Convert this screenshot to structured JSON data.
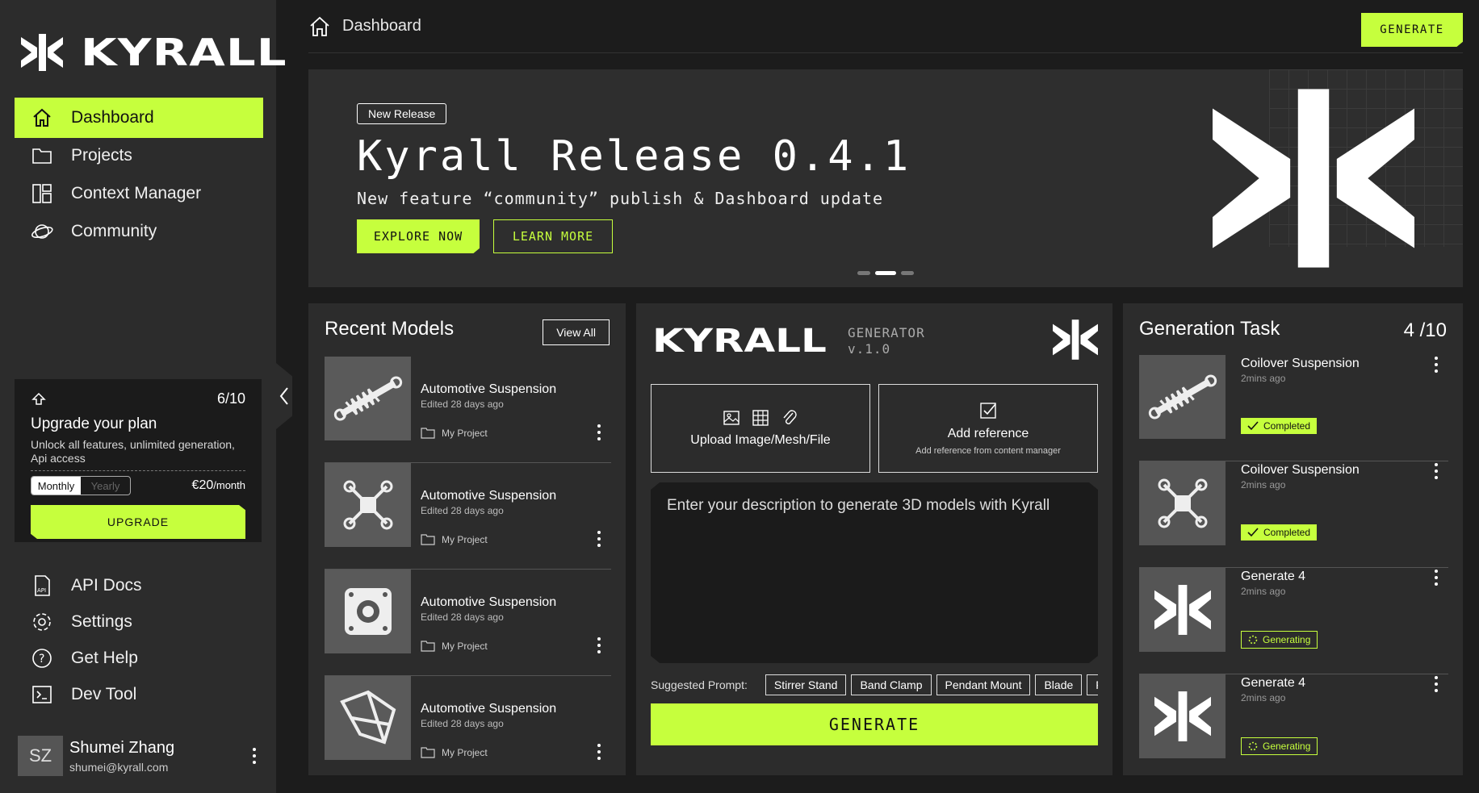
{
  "brand": "KYRALL",
  "sidebar": {
    "nav": [
      "Dashboard",
      "Projects",
      "Context Manager",
      "Community"
    ],
    "bottom_nav": [
      "API Docs",
      "Settings",
      "Get Help",
      "Dev Tool"
    ],
    "upgrade": {
      "count": "6/10",
      "title": "Upgrade your plan",
      "desc": "Unlock all features, unlimited  generation, Api access",
      "monthly": "Monthly",
      "yearly": "Yearly",
      "price": "€20",
      "per": "/month",
      "button": "UPGRADE"
    },
    "user": {
      "initials": "SZ",
      "name": "Shumei Zhang",
      "email": "shumei@kyrall.com"
    }
  },
  "header": {
    "breadcrumb": "Dashboard",
    "generate": "GENERATE"
  },
  "banner": {
    "badge": "New Release",
    "title": "Kyrall Release 0.4.1",
    "subtitle": "New feature “community” publish & Dashboard update",
    "explore": "EXPLORE NOW",
    "learn": "LEARN MORE"
  },
  "recent": {
    "title": "Recent Models",
    "view_all": "View All",
    "items": [
      {
        "name": "Automotive Suspension",
        "edited": "Edited 28 days ago",
        "project": "My Project"
      },
      {
        "name": "Automotive Suspension",
        "edited": "Edited 28 days ago",
        "project": "My Project"
      },
      {
        "name": "Automotive Suspension",
        "edited": "Edited 28 days ago",
        "project": "My Project"
      },
      {
        "name": "Automotive Suspension",
        "edited": "Edited 28 days ago",
        "project": "My Project"
      }
    ]
  },
  "generator": {
    "logo": "KYRALL",
    "label": "GENERATOR",
    "version": "v.1.0",
    "upload": "Upload Image/Mesh/File",
    "ref_title": "Add reference",
    "ref_sub": "Add reference from content manager",
    "placeholder": "Enter your description to generate 3D models with Kyrall",
    "suggest_label": "Suggested Prompt:",
    "chips": [
      "Stirrer Stand",
      "Band Clamp",
      "Pendant Mount",
      "Blade",
      "P"
    ],
    "button": "GENERATE"
  },
  "tasks": {
    "title": "Generation Task",
    "count": "4 /10",
    "items": [
      {
        "name": "Coilover Suspension",
        "time": "2mins ago",
        "status": "Completed"
      },
      {
        "name": "Coilover Suspension",
        "time": "2mins ago",
        "status": "Completed"
      },
      {
        "name": "Generate 4",
        "time": "2mins ago",
        "status": "Generating"
      },
      {
        "name": "Generate 4",
        "time": "2mins ago",
        "status": "Generating"
      }
    ]
  },
  "colors": {
    "accent": "#c6ff3d",
    "bg": "#1c1c1c",
    "panel": "#2c2c2c"
  }
}
